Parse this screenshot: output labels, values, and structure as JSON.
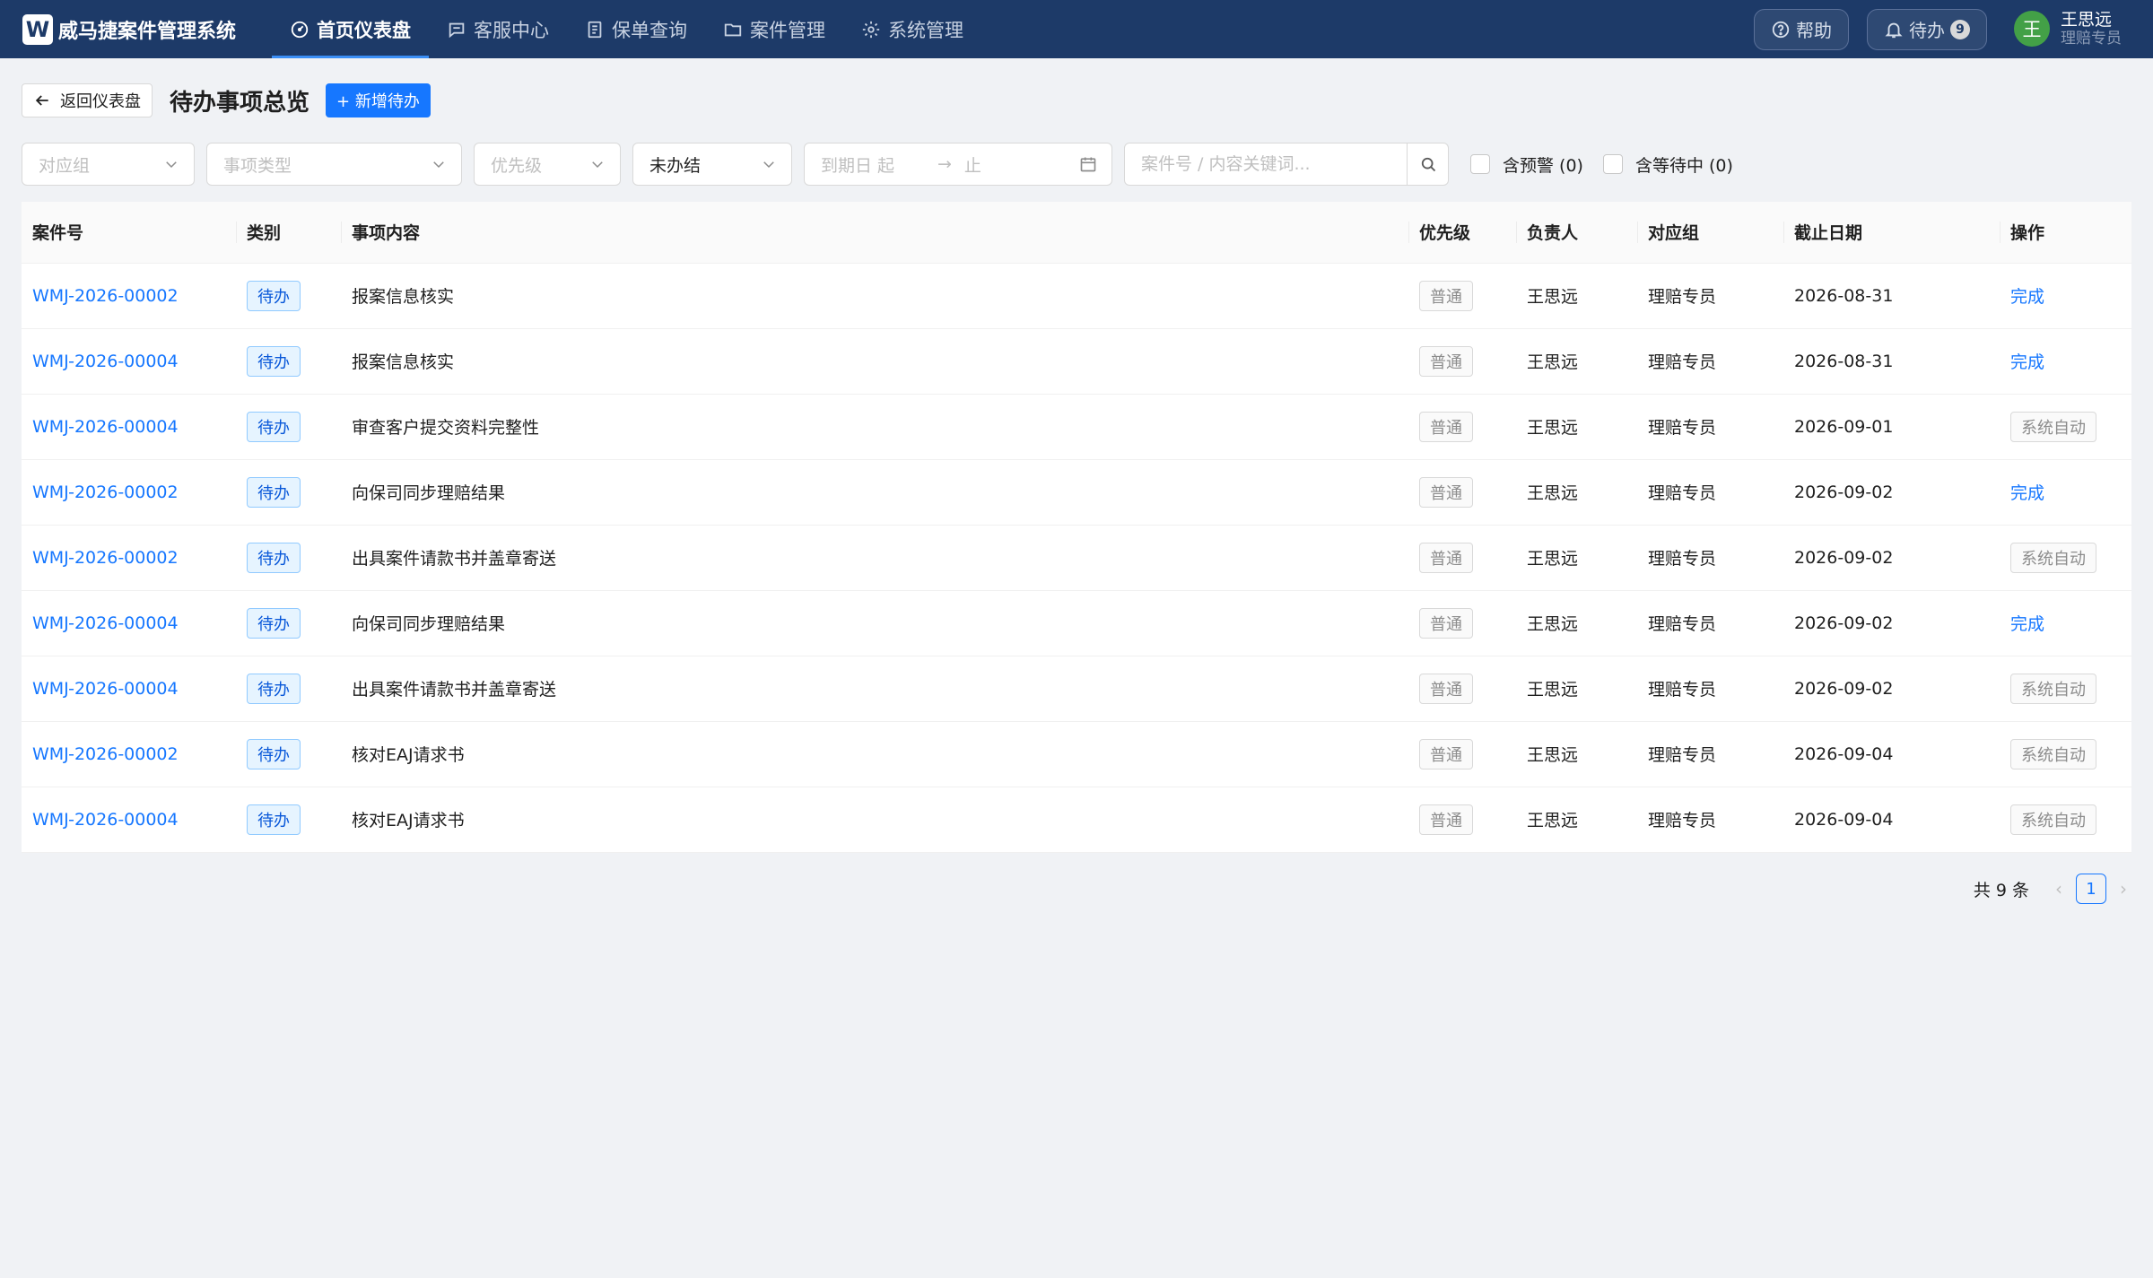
{
  "app": {
    "logo_letter": "W",
    "title": "威马捷案件管理系统"
  },
  "nav": {
    "items": [
      {
        "label": "首页仪表盘",
        "icon": "dashboard-icon",
        "active": true
      },
      {
        "label": "客服中心",
        "icon": "chat-icon",
        "active": false
      },
      {
        "label": "保单查询",
        "icon": "document-icon",
        "active": false
      },
      {
        "label": "案件管理",
        "icon": "folder-icon",
        "active": false
      },
      {
        "label": "系统管理",
        "icon": "gear-icon",
        "active": false
      }
    ]
  },
  "topbar": {
    "help_label": "帮助",
    "todo_label": "待办",
    "todo_count": "9"
  },
  "user": {
    "avatar_char": "王",
    "name": "王思远",
    "role": "理赔专员",
    "avatar_color": "#43a047"
  },
  "header": {
    "back_label": "返回仪表盘",
    "title": "待办事项总览",
    "add_label": "+ 新增待办"
  },
  "filters": {
    "group_placeholder": "对应组",
    "type_placeholder": "事项类型",
    "priority_placeholder": "优先级",
    "status_value": "未办结",
    "date_start_placeholder": "到期日 起",
    "date_arrow": "→",
    "date_end_placeholder": "止",
    "search_placeholder": "案件号 / 内容关键词...",
    "include_warning_label": "含预警 (0)",
    "include_waiting_label": "含等待中 (0)"
  },
  "table": {
    "columns": [
      "案件号",
      "类别",
      "事项内容",
      "优先级",
      "负责人",
      "对应组",
      "截止日期",
      "操作"
    ],
    "rows": [
      {
        "case_no": "WMJ-2026-00002",
        "category": "待办",
        "content": "报案信息核实",
        "priority": "普通",
        "owner": "王思远",
        "group": "理赔专员",
        "deadline": "2026-08-31",
        "action": "完成",
        "action_type": "link"
      },
      {
        "case_no": "WMJ-2026-00004",
        "category": "待办",
        "content": "报案信息核实",
        "priority": "普通",
        "owner": "王思远",
        "group": "理赔专员",
        "deadline": "2026-08-31",
        "action": "完成",
        "action_type": "link"
      },
      {
        "case_no": "WMJ-2026-00004",
        "category": "待办",
        "content": "审查客户提交资料完整性",
        "priority": "普通",
        "owner": "王思远",
        "group": "理赔专员",
        "deadline": "2026-09-01",
        "action": "系统自动",
        "action_type": "tag"
      },
      {
        "case_no": "WMJ-2026-00002",
        "category": "待办",
        "content": "向保司同步理赔结果",
        "priority": "普通",
        "owner": "王思远",
        "group": "理赔专员",
        "deadline": "2026-09-02",
        "action": "完成",
        "action_type": "link"
      },
      {
        "case_no": "WMJ-2026-00002",
        "category": "待办",
        "content": "出具案件请款书并盖章寄送",
        "priority": "普通",
        "owner": "王思远",
        "group": "理赔专员",
        "deadline": "2026-09-02",
        "action": "系统自动",
        "action_type": "tag"
      },
      {
        "case_no": "WMJ-2026-00004",
        "category": "待办",
        "content": "向保司同步理赔结果",
        "priority": "普通",
        "owner": "王思远",
        "group": "理赔专员",
        "deadline": "2026-09-02",
        "action": "完成",
        "action_type": "link"
      },
      {
        "case_no": "WMJ-2026-00004",
        "category": "待办",
        "content": "出具案件请款书并盖章寄送",
        "priority": "普通",
        "owner": "王思远",
        "group": "理赔专员",
        "deadline": "2026-09-02",
        "action": "系统自动",
        "action_type": "tag"
      },
      {
        "case_no": "WMJ-2026-00002",
        "category": "待办",
        "content": "核对EAJ请求书",
        "priority": "普通",
        "owner": "王思远",
        "group": "理赔专员",
        "deadline": "2026-09-04",
        "action": "系统自动",
        "action_type": "tag"
      },
      {
        "case_no": "WMJ-2026-00004",
        "category": "待办",
        "content": "核对EAJ请求书",
        "priority": "普通",
        "owner": "王思远",
        "group": "理赔专员",
        "deadline": "2026-09-04",
        "action": "系统自动",
        "action_type": "tag"
      }
    ]
  },
  "pagination": {
    "total_label": "共 9 条",
    "current_page": "1",
    "prev_icon": "‹",
    "next_icon": "›"
  },
  "colors": {
    "topbar": "#1d3a68",
    "primary": "#1677ff",
    "page_bg": "#f0f2f5"
  }
}
